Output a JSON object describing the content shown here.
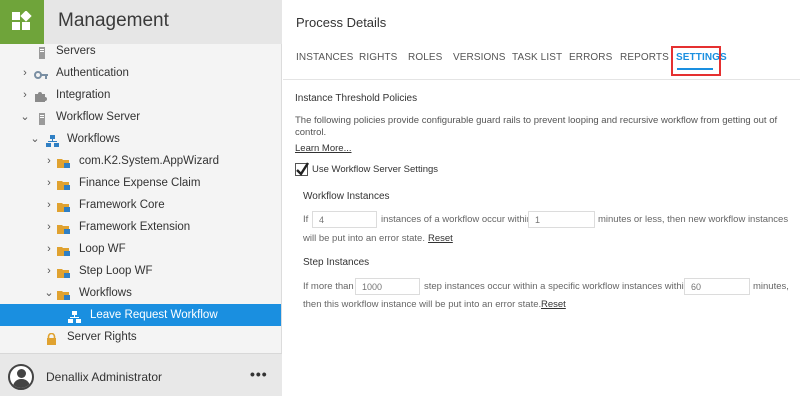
{
  "app": {
    "title": "Management"
  },
  "sidebar": {
    "items": [
      {
        "label": "Servers"
      },
      {
        "label": "Authentication"
      },
      {
        "label": "Integration"
      },
      {
        "label": "Workflow Server"
      },
      {
        "label": "Workflows"
      },
      {
        "label": "com.K2.System.AppWizard"
      },
      {
        "label": "Finance Expense Claim"
      },
      {
        "label": "Framework Core"
      },
      {
        "label": "Framework Extension"
      },
      {
        "label": "Loop WF"
      },
      {
        "label": "Step Loop WF"
      },
      {
        "label": "Workflows"
      },
      {
        "label": "Leave Request Workflow"
      },
      {
        "label": "Server Rights"
      }
    ]
  },
  "user": {
    "name": "Denallix Administrator",
    "more_label": "•••"
  },
  "main": {
    "title": "Process Details",
    "tabs": [
      "INSTANCES",
      "RIGHTS",
      "ROLES",
      "VERSIONS",
      "TASK LIST",
      "ERRORS",
      "REPORTS",
      "SETTINGS"
    ],
    "active_tab": "SETTINGS",
    "section_title": "Instance Threshold Policies",
    "description": "The following policies provide configurable guard rails to prevent looping and recursive workflow from getting out of control.",
    "learn_more": "Learn More...",
    "use_server_settings_label": "Use Workflow Server Settings",
    "use_server_settings_checked": true,
    "workflow_instances": {
      "title": "Workflow Instances",
      "text_if": "If",
      "instances_placeholder": "4",
      "text_mid": "instances of a workflow occur within",
      "minutes_placeholder": "1",
      "text_end": "minutes or less, then new workflow instances",
      "text_line2": "will be put into an error state.",
      "reset": "Reset"
    },
    "step_instances": {
      "title": "Step Instances",
      "text_if": "If more than",
      "steps_placeholder": "1000",
      "text_mid": "step instances occur within a specific workflow instances within",
      "minutes_placeholder": "60",
      "text_end": "minutes,",
      "text_line2": "then this workflow instance will be put into an error state.",
      "reset": "Reset"
    }
  },
  "colors": {
    "accent": "#1a8fe0",
    "logo": "#6fa43a",
    "highlight": "#e53030"
  }
}
